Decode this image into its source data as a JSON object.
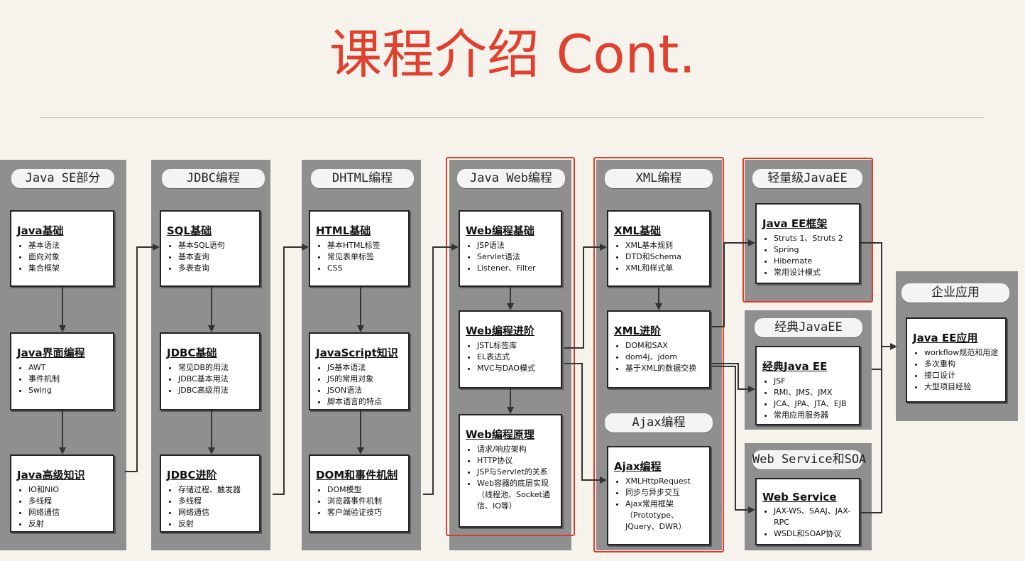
{
  "title": "课程介绍 Cont.",
  "columns": {
    "java_se": {
      "title": "Java SE部分",
      "cards": [
        {
          "title": "Java基础",
          "items": [
            "基本语法",
            "面向对象",
            "集合框架"
          ]
        },
        {
          "title": "Java界面编程",
          "items": [
            "AWT",
            "事件机制",
            "Swing"
          ]
        },
        {
          "title": "Java高级知识",
          "items": [
            "IO和NIO",
            "多线程",
            "网络通信",
            "反射"
          ]
        }
      ]
    },
    "jdbc": {
      "title": "JDBC编程",
      "cards": [
        {
          "title": "SQL基础",
          "items": [
            "基本SQL语句",
            "基本查询",
            "多表查询"
          ]
        },
        {
          "title": "JDBC基础",
          "items": [
            "常见DB的用法",
            "JDBC基本用法",
            "JDBC高级用法"
          ]
        },
        {
          "title": "JDBC进阶",
          "items": [
            "存储过程、触发器",
            "多线程",
            "网络通信",
            "反射"
          ]
        }
      ]
    },
    "dhtml": {
      "title": "DHTML编程",
      "cards": [
        {
          "title": "HTML基础",
          "items": [
            "基本HTML标签",
            "常见表单标签",
            "CSS"
          ]
        },
        {
          "title": "JavaScript知识",
          "items": [
            "JS基本语法",
            "JS的常用对象",
            "JSON语法",
            "脚本语言的特点"
          ]
        },
        {
          "title": "DOM和事件机制",
          "items": [
            "DOM模型",
            "浏览器事件机制",
            "客户端验证技巧"
          ]
        }
      ]
    },
    "javaweb": {
      "title": "Java Web编程",
      "cards": [
        {
          "title": "Web编程基础",
          "items": [
            "JSP语法",
            "Servlet语法",
            "Listener、Filter"
          ]
        },
        {
          "title": "Web编程进阶",
          "items": [
            "JSTL标签库",
            "EL表达式",
            "MVC与DAO模式"
          ]
        },
        {
          "title": "Web编程原理",
          "items": [
            "请求/响应架构",
            "HTTP协议",
            "JSP与Servlet的关系",
            "Web容器的底层实现（线程池、Socket通信、IO等）"
          ]
        }
      ]
    },
    "xml": {
      "title": "XML编程",
      "cards": [
        {
          "title": "XML基础",
          "items": [
            "XML基本规则",
            "DTD和Schema",
            "XML和样式单"
          ]
        },
        {
          "title": "XML进阶",
          "items": [
            "DOM和SAX",
            "dom4j、jdom",
            "基于XML的数据交换"
          ]
        }
      ]
    },
    "ajax": {
      "title": "Ajax编程",
      "cards": [
        {
          "title": "Ajax编程",
          "items": [
            "XMLHttpRequest",
            "同步与异步交互",
            "Ajax常用框架（Prototype、JQuery、DWR）"
          ]
        }
      ]
    },
    "light": {
      "title": "轻量级JavaEE",
      "cards": [
        {
          "title": "Java EE框架",
          "items": [
            "Struts 1、Struts 2",
            "Spring",
            "Hibernate",
            "常用设计模式"
          ]
        }
      ]
    },
    "classic": {
      "title": "经典JavaEE",
      "cards": [
        {
          "title": "经典Java EE",
          "items": [
            "JSF",
            "RMI、JMS、JMX",
            "JCA、JPA、JTA、EJB",
            "常用应用服务器"
          ]
        }
      ]
    },
    "ws": {
      "title": "Web Service和SOA",
      "cards": [
        {
          "title": "Web Service",
          "items": [
            "JAX-WS、SAAJ、JAX-RPC",
            "WSDL和SOAP协议"
          ]
        }
      ]
    },
    "enterprise": {
      "title": "企业应用",
      "cards": [
        {
          "title": "Java EE应用",
          "items": [
            "workflow规范和用途",
            "多次重构",
            "接口设计",
            "大型项目经验"
          ]
        }
      ]
    }
  }
}
